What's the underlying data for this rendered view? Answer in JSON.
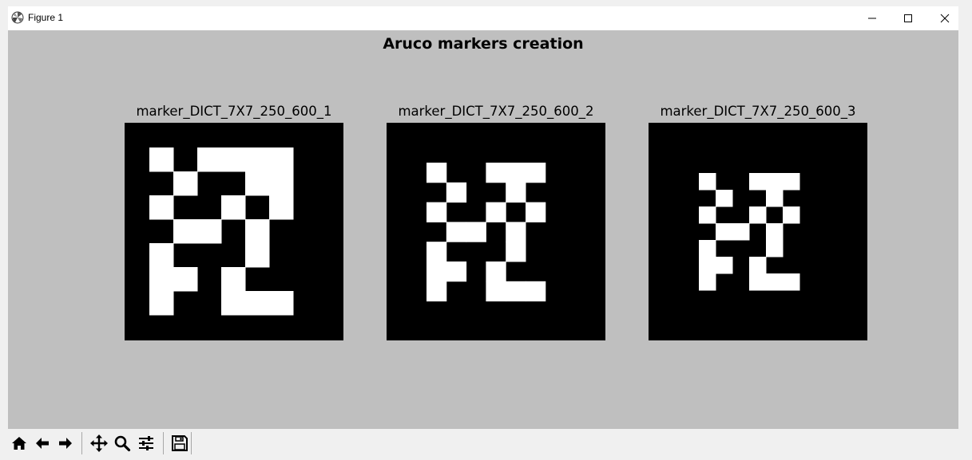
{
  "window": {
    "title": "Figure 1",
    "icon": "matplotlib-logo-icon",
    "controls": [
      "minimize-icon",
      "maximize-icon",
      "close-icon"
    ]
  },
  "figure": {
    "suptitle": "Aruco markers creation",
    "background": "#bfbfbf",
    "markers": [
      {
        "title": "marker_DICT_7X7_250_600_1",
        "grid": [
          "101111",
          "010011",
          "100101",
          "011010",
          "100010",
          "110100",
          "100111"
        ]
      },
      {
        "title": "marker_DICT_7X7_250_600_2",
        "grid": [
          "100111",
          "010010",
          "100101",
          "011010",
          "100010",
          "110100",
          "100111"
        ]
      },
      {
        "title": "marker_DICT_7X7_250_600_3",
        "grid": [
          "100111",
          "010010",
          "100101",
          "011010",
          "100010",
          "110100",
          "100111"
        ]
      }
    ]
  },
  "toolbar": {
    "tools": [
      "home-icon",
      "back-arrow-icon",
      "forward-arrow-icon",
      "pan-icon",
      "zoom-icon",
      "configure-subplots-icon",
      "save-icon"
    ]
  }
}
